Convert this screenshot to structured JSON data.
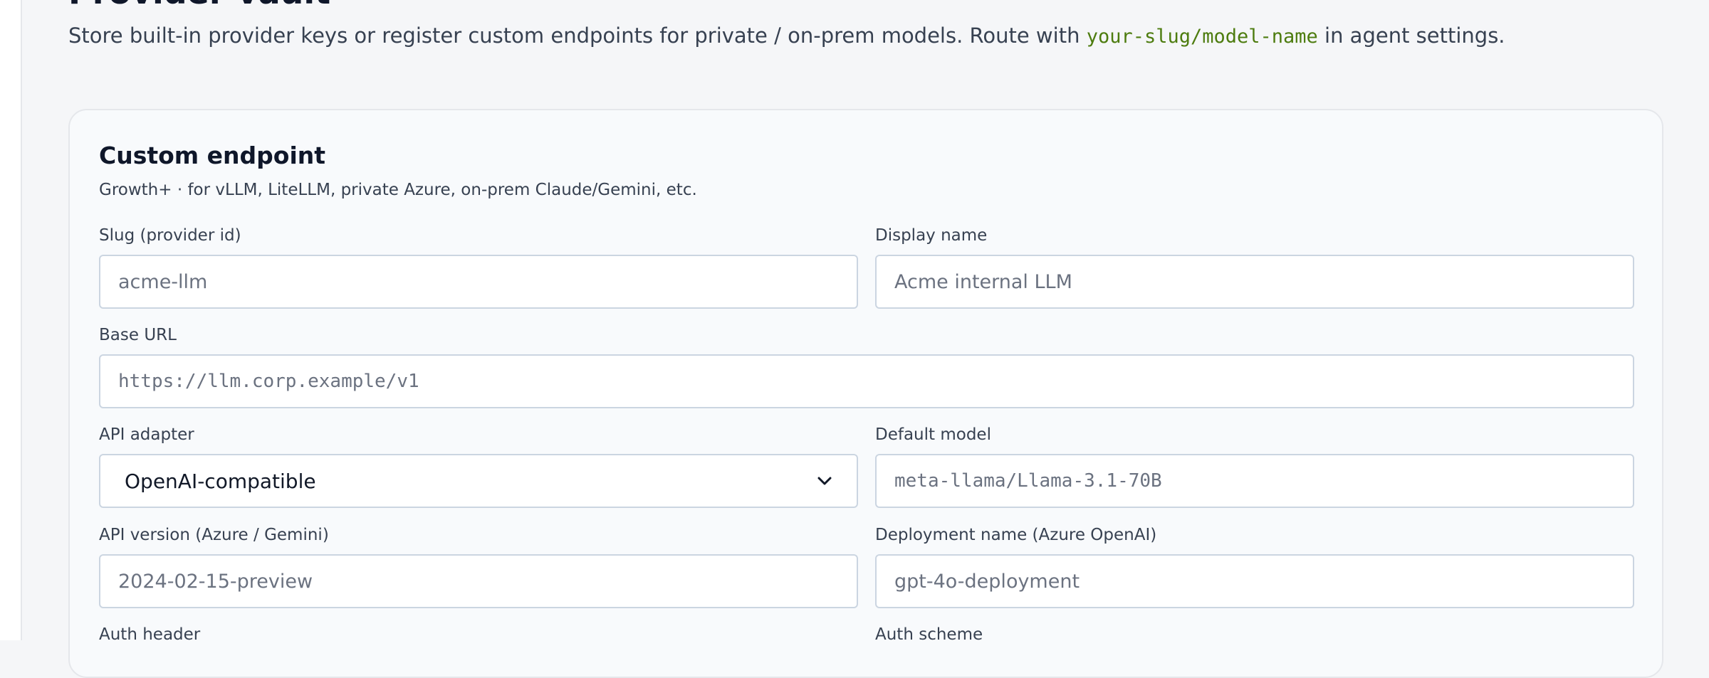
{
  "page": {
    "title": "Provider vault",
    "description_prefix": "Store built-in provider keys or register custom endpoints for private / on-prem models. Route with",
    "description_code": "your-slug/model-name",
    "description_suffix": "in agent settings."
  },
  "custom_endpoint": {
    "title": "Custom endpoint",
    "subtitle": "Growth+ · for vLLM, LiteLLM, private Azure, on-prem Claude/Gemini, etc.",
    "fields": {
      "slug": {
        "label": "Slug (provider id)",
        "placeholder": "acme-llm"
      },
      "display_name": {
        "label": "Display name",
        "placeholder": "Acme internal LLM"
      },
      "base_url": {
        "label": "Base URL",
        "placeholder": "https://llm.corp.example/v1"
      },
      "api_adapter": {
        "label": "API adapter",
        "selected": "OpenAI-compatible"
      },
      "default_model": {
        "label": "Default model",
        "placeholder": "meta-llama/Llama-3.1-70B"
      },
      "api_version": {
        "label": "API version (Azure / Gemini)",
        "placeholder": "2024-02-15-preview"
      },
      "deployment_name": {
        "label": "Deployment name (Azure OpenAI)",
        "placeholder": "gpt-4o-deployment"
      },
      "auth_header": {
        "label": "Auth header"
      },
      "auth_scheme": {
        "label": "Auth scheme"
      }
    }
  },
  "icons": {
    "select_chevron": "chevron-down-icon"
  },
  "colors": {
    "code_accent": "#4d7c0f",
    "card_bg": "#f8fafc",
    "page_bg": "#f5f6f8"
  }
}
